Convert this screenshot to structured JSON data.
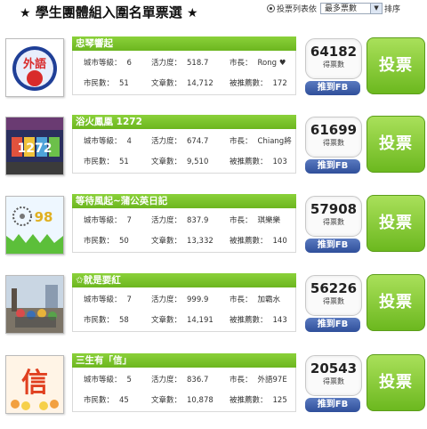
{
  "header": {
    "title": "學生團體組入圍名單票選",
    "star_left": "★",
    "star_right": "★"
  },
  "sort": {
    "label": "投票列表依",
    "selected": "最多票數",
    "button": "排序"
  },
  "labels": {
    "city_level": "城市等級：",
    "vitality": "活力度：",
    "mayor": "市長：",
    "citizens": "市民數：",
    "articles": "文章數：",
    "recommended": "被推薦數：",
    "votes_unit": "得票數",
    "fb_button": "推到FB",
    "vote_button": "投票"
  },
  "colors": {
    "name_bar": "#79c22a",
    "vote_button": "#84c934",
    "fb_button": "#3b5ba5"
  },
  "entries": [
    {
      "name": "忠琴響起",
      "city_level": "6",
      "vitality": "518.7",
      "mayor": "Rong ♥",
      "citizens": "51",
      "articles": "14,712",
      "recommended": "172",
      "votes": "64182",
      "thumb_text": "外語"
    },
    {
      "name": "浴火鳳凰 1272",
      "city_level": "4",
      "vitality": "674.7",
      "mayor": "Chiang將",
      "citizens": "51",
      "articles": "9,510",
      "recommended": "103",
      "votes": "61699",
      "thumb_text": "1272"
    },
    {
      "name": "等待風起~蒲公英日記",
      "city_level": "7",
      "vitality": "837.9",
      "mayor": "琪樂樂",
      "citizens": "50",
      "articles": "13,332",
      "recommended": "140",
      "votes": "57908",
      "thumb_text": "98"
    },
    {
      "name": "✩就是要紅",
      "city_level": "7",
      "vitality": "999.9",
      "mayor": "加霸水",
      "citizens": "58",
      "articles": "14,191",
      "recommended": "143",
      "votes": "56226",
      "thumb_text": ""
    },
    {
      "name": "三生有「信」",
      "city_level": "5",
      "vitality": "836.7",
      "mayor": "外語97E",
      "citizens": "45",
      "articles": "10,878",
      "recommended": "125",
      "votes": "20543",
      "thumb_text": "信"
    }
  ]
}
